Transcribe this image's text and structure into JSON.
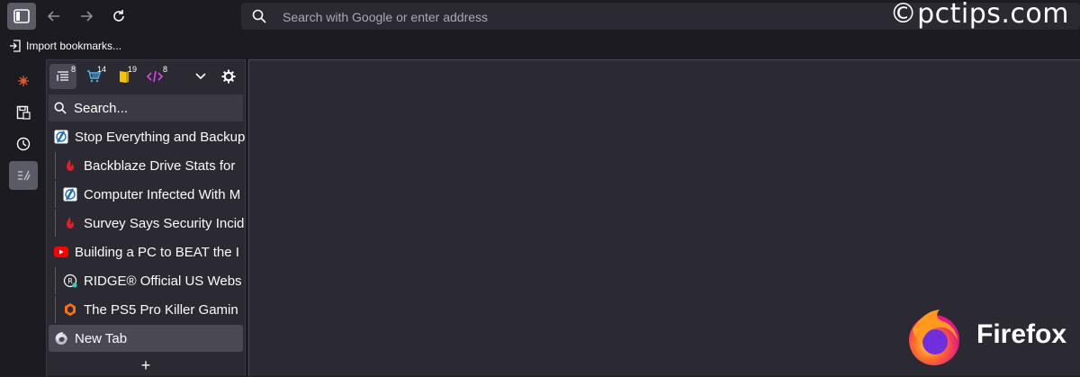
{
  "watermark": "©pctips.com",
  "toolbar": {
    "sidebar_icon": "sidebar-icon",
    "back_icon": "back-arrow-icon",
    "forward_icon": "forward-arrow-icon",
    "reload_icon": "reload-icon",
    "url_placeholder": "Search with Google or enter address"
  },
  "bookmarks_bar": {
    "import_label": "Import bookmarks..."
  },
  "sidebar_strip": {
    "items": [
      "extension-icon",
      "save-icon",
      "history-icon",
      "tree-tabs-icon"
    ]
  },
  "panel": {
    "tabs": [
      {
        "icon": "tab-list-icon",
        "badge": "8"
      },
      {
        "icon": "cart-icon",
        "badge": "14"
      },
      {
        "icon": "book-icon",
        "badge": "19"
      },
      {
        "icon": "code-icon",
        "badge": "8"
      }
    ],
    "search_placeholder": "Search...",
    "tab_items": [
      {
        "title": "Stop Everything and Backup",
        "favicon": "pctips-icon",
        "level": 0
      },
      {
        "title": "Backblaze Drive Stats for",
        "favicon": "backblaze-icon",
        "level": 1
      },
      {
        "title": "Computer Infected With M",
        "favicon": "pctips-icon",
        "level": 1
      },
      {
        "title": "Survey Says Security Incid",
        "favicon": "backblaze-icon",
        "level": 1
      },
      {
        "title": "Building a PC to BEAT the I",
        "favicon": "youtube-icon",
        "level": 0
      },
      {
        "title": "RIDGE® Official US Webs",
        "favicon": "ridge-icon",
        "level": 1
      },
      {
        "title": "The PS5 Pro Killer Gamin",
        "favicon": "hardware-icon",
        "level": 1
      },
      {
        "title": "New Tab",
        "favicon": "firefox-icon",
        "level": 0,
        "selected": true
      }
    ],
    "add_label": "+"
  },
  "branding": {
    "name": "Firefox"
  },
  "colors": {
    "background": "#1c1b22",
    "panel": "#2b2a33",
    "accent_purple": "#a855f7",
    "youtube_red": "#ff0000"
  }
}
